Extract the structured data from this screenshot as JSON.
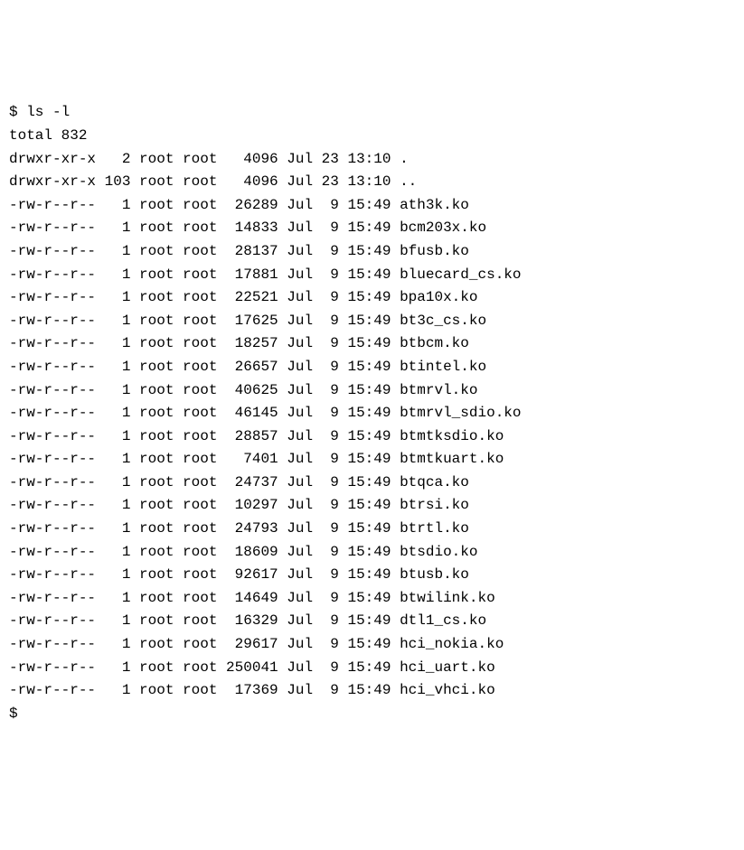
{
  "prompt1": "$ ",
  "command": "ls -l",
  "total_line": "total 832",
  "entries": [
    {
      "perms": "drwxr-xr-x",
      "links": "2",
      "owner": "root",
      "group": "root",
      "size": "4096",
      "month": "Jul",
      "day": "23",
      "time": "13:10",
      "name": "."
    },
    {
      "perms": "drwxr-xr-x",
      "links": "103",
      "owner": "root",
      "group": "root",
      "size": "4096",
      "month": "Jul",
      "day": "23",
      "time": "13:10",
      "name": ".."
    },
    {
      "perms": "-rw-r--r--",
      "links": "1",
      "owner": "root",
      "group": "root",
      "size": "26289",
      "month": "Jul",
      "day": "9",
      "time": "15:49",
      "name": "ath3k.ko"
    },
    {
      "perms": "-rw-r--r--",
      "links": "1",
      "owner": "root",
      "group": "root",
      "size": "14833",
      "month": "Jul",
      "day": "9",
      "time": "15:49",
      "name": "bcm203x.ko"
    },
    {
      "perms": "-rw-r--r--",
      "links": "1",
      "owner": "root",
      "group": "root",
      "size": "28137",
      "month": "Jul",
      "day": "9",
      "time": "15:49",
      "name": "bfusb.ko"
    },
    {
      "perms": "-rw-r--r--",
      "links": "1",
      "owner": "root",
      "group": "root",
      "size": "17881",
      "month": "Jul",
      "day": "9",
      "time": "15:49",
      "name": "bluecard_cs.ko"
    },
    {
      "perms": "-rw-r--r--",
      "links": "1",
      "owner": "root",
      "group": "root",
      "size": "22521",
      "month": "Jul",
      "day": "9",
      "time": "15:49",
      "name": "bpa10x.ko"
    },
    {
      "perms": "-rw-r--r--",
      "links": "1",
      "owner": "root",
      "group": "root",
      "size": "17625",
      "month": "Jul",
      "day": "9",
      "time": "15:49",
      "name": "bt3c_cs.ko"
    },
    {
      "perms": "-rw-r--r--",
      "links": "1",
      "owner": "root",
      "group": "root",
      "size": "18257",
      "month": "Jul",
      "day": "9",
      "time": "15:49",
      "name": "btbcm.ko"
    },
    {
      "perms": "-rw-r--r--",
      "links": "1",
      "owner": "root",
      "group": "root",
      "size": "26657",
      "month": "Jul",
      "day": "9",
      "time": "15:49",
      "name": "btintel.ko"
    },
    {
      "perms": "-rw-r--r--",
      "links": "1",
      "owner": "root",
      "group": "root",
      "size": "40625",
      "month": "Jul",
      "day": "9",
      "time": "15:49",
      "name": "btmrvl.ko"
    },
    {
      "perms": "-rw-r--r--",
      "links": "1",
      "owner": "root",
      "group": "root",
      "size": "46145",
      "month": "Jul",
      "day": "9",
      "time": "15:49",
      "name": "btmrvl_sdio.ko"
    },
    {
      "perms": "-rw-r--r--",
      "links": "1",
      "owner": "root",
      "group": "root",
      "size": "28857",
      "month": "Jul",
      "day": "9",
      "time": "15:49",
      "name": "btmtksdio.ko"
    },
    {
      "perms": "-rw-r--r--",
      "links": "1",
      "owner": "root",
      "group": "root",
      "size": "7401",
      "month": "Jul",
      "day": "9",
      "time": "15:49",
      "name": "btmtkuart.ko"
    },
    {
      "perms": "-rw-r--r--",
      "links": "1",
      "owner": "root",
      "group": "root",
      "size": "24737",
      "month": "Jul",
      "day": "9",
      "time": "15:49",
      "name": "btqca.ko"
    },
    {
      "perms": "-rw-r--r--",
      "links": "1",
      "owner": "root",
      "group": "root",
      "size": "10297",
      "month": "Jul",
      "day": "9",
      "time": "15:49",
      "name": "btrsi.ko"
    },
    {
      "perms": "-rw-r--r--",
      "links": "1",
      "owner": "root",
      "group": "root",
      "size": "24793",
      "month": "Jul",
      "day": "9",
      "time": "15:49",
      "name": "btrtl.ko"
    },
    {
      "perms": "-rw-r--r--",
      "links": "1",
      "owner": "root",
      "group": "root",
      "size": "18609",
      "month": "Jul",
      "day": "9",
      "time": "15:49",
      "name": "btsdio.ko"
    },
    {
      "perms": "-rw-r--r--",
      "links": "1",
      "owner": "root",
      "group": "root",
      "size": "92617",
      "month": "Jul",
      "day": "9",
      "time": "15:49",
      "name": "btusb.ko"
    },
    {
      "perms": "-rw-r--r--",
      "links": "1",
      "owner": "root",
      "group": "root",
      "size": "14649",
      "month": "Jul",
      "day": "9",
      "time": "15:49",
      "name": "btwilink.ko"
    },
    {
      "perms": "-rw-r--r--",
      "links": "1",
      "owner": "root",
      "group": "root",
      "size": "16329",
      "month": "Jul",
      "day": "9",
      "time": "15:49",
      "name": "dtl1_cs.ko"
    },
    {
      "perms": "-rw-r--r--",
      "links": "1",
      "owner": "root",
      "group": "root",
      "size": "29617",
      "month": "Jul",
      "day": "9",
      "time": "15:49",
      "name": "hci_nokia.ko"
    },
    {
      "perms": "-rw-r--r--",
      "links": "1",
      "owner": "root",
      "group": "root",
      "size": "250041",
      "month": "Jul",
      "day": "9",
      "time": "15:49",
      "name": "hci_uart.ko"
    },
    {
      "perms": "-rw-r--r--",
      "links": "1",
      "owner": "root",
      "group": "root",
      "size": "17369",
      "month": "Jul",
      "day": "9",
      "time": "15:49",
      "name": "hci_vhci.ko"
    }
  ],
  "prompt2": "$"
}
